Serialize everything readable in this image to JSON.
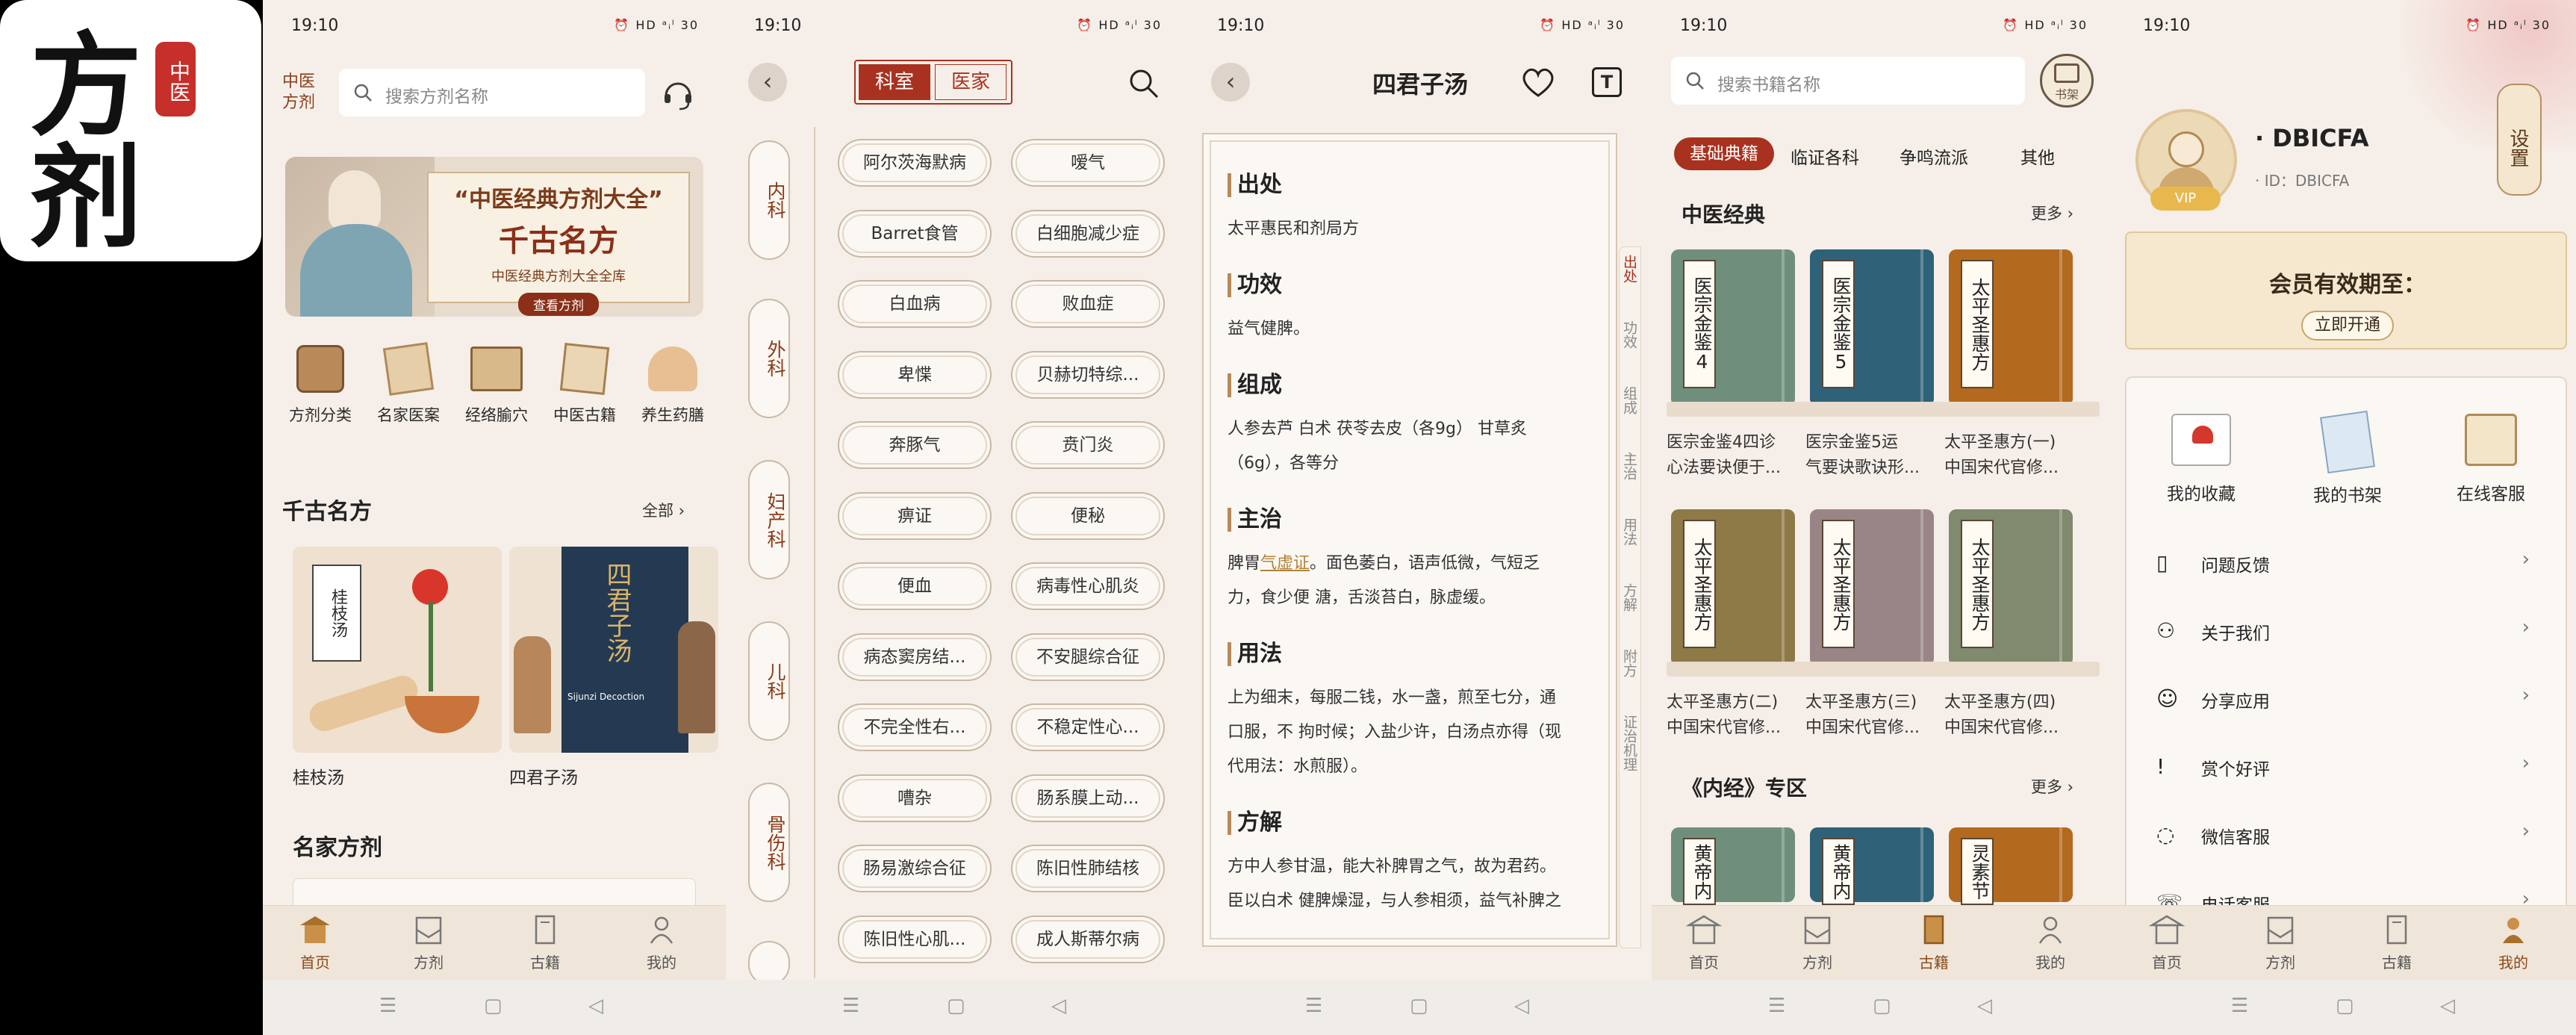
{
  "app_logo": {
    "main": "方剂",
    "seal": "中医"
  },
  "status": {
    "time": "19:10",
    "icons": "⏰ HD ᵃᵢˡ 30"
  },
  "s1": {
    "logo_top": "中医",
    "logo_bottom": "方剂",
    "search_placeholder": "搜索方剂名称",
    "banner": {
      "title_top": "“中医经典方剂大全”",
      "title_main": "千古名方",
      "subtitle": "中医经典方剂大全全库",
      "button": "查看方剂"
    },
    "categories": [
      "方剂分类",
      "名家医案",
      "经络腧穴",
      "中医古籍",
      "养生药膳"
    ],
    "section1": {
      "title": "千古名方",
      "more": "全部"
    },
    "cards": [
      {
        "name": "桂枝汤",
        "art_text": "桂枝汤"
      },
      {
        "name": "四君子汤",
        "art_text": "四君子汤",
        "art_en": "Sijunzi Decoction"
      }
    ],
    "section2": {
      "title": "名家方剂"
    }
  },
  "tabs": [
    "首页",
    "方剂",
    "古籍",
    "我的"
  ],
  "s2": {
    "seg_left": "科室",
    "seg_right": "医家",
    "side": [
      "内科",
      "外科",
      "妇产科",
      "儿科",
      "骨伤科"
    ],
    "diseases": [
      "阿尔茨海默病",
      "嗳气",
      "Barret食管",
      "白细胞减少症",
      "白血病",
      "败血症",
      "卑惵",
      "贝赫切特综...",
      "奔豚气",
      "贲门炎",
      "痹证",
      "便秘",
      "便血",
      "病毒性心肌炎",
      "病态窦房结...",
      "不安腿综合征",
      "不完全性右...",
      "不稳定性心...",
      "嘈杂",
      "肠系膜上动...",
      "肠易激综合征",
      "陈旧性肺结核",
      "陈旧性心肌...",
      "成人斯蒂尔病"
    ]
  },
  "s3": {
    "title": "四君子汤",
    "font_btn": "T",
    "sections": [
      {
        "h": "出处",
        "p": [
          "太平惠民和剂局方"
        ]
      },
      {
        "h": "功效",
        "p": [
          "益气健脾。"
        ]
      },
      {
        "h": "组成",
        "p": [
          "人参去芦 白术 茯苓去皮（各9g） 甘草炙",
          "（6g），各等分"
        ]
      },
      {
        "h": "主治",
        "p1_pre": "脾胃",
        "p1_link": "气虚证",
        "p1_post": "。面色萎白，语声低微，气短乏",
        "p": [
          "力，食少便 溏，舌淡苔白，脉虚缓。"
        ]
      },
      {
        "h": "用法",
        "p": [
          "上为细末，每服二钱，水一盏，煎至七分，通",
          "口服，不 拘时候；入盐少许，白汤点亦得（现",
          "代用法：水煎服）。"
        ]
      },
      {
        "h": "方解",
        "p": [
          "方中人参甘温，能大补脾胃之气，故为君药。",
          "臣以白术 健脾燥湿，与人参相须，益气补脾之"
        ]
      }
    ],
    "side_index": [
      "出处",
      "功效",
      "组成",
      "主治",
      "用法",
      "方解",
      "附方",
      "证治机理"
    ]
  },
  "s4": {
    "search_placeholder": "搜索书籍名称",
    "shelf_label": "书架",
    "tabs": [
      "基础典籍",
      "临证各科",
      "争鸣流派",
      "其他"
    ],
    "section1": {
      "title": "中医经典",
      "more": "更多"
    },
    "books1": [
      {
        "label": "医宗金鉴4",
        "t1": "医宗金鉴4四诊",
        "t2": "心法要诀便于...",
        "color": "#6f8f7c"
      },
      {
        "label": "医宗金鉴5",
        "t1": "医宗金鉴5运",
        "t2": "气要诀歌诀形...",
        "color": "#2f6278"
      },
      {
        "label": "太平圣惠方",
        "t1": "太平圣惠方(一)",
        "t2": "中国宋代官修...",
        "color": "#b36a1e"
      }
    ],
    "books2": [
      {
        "label": "太平圣惠方",
        "t1": "太平圣惠方(二)",
        "t2": "中国宋代官修...",
        "color": "#8e7a47"
      },
      {
        "label": "太平圣惠方",
        "t1": "太平圣惠方(三)",
        "t2": "中国宋代官修...",
        "color": "#9a8586"
      },
      {
        "label": "太平圣惠方",
        "t1": "太平圣惠方(四)",
        "t2": "中国宋代官修...",
        "color": "#7f8a6e"
      }
    ],
    "section2": {
      "title": "《内经》专区",
      "more": "更多"
    },
    "books3": [
      {
        "label": "黄帝内",
        "color": "#6f8f7c"
      },
      {
        "label": "黄帝内",
        "color": "#2f6278"
      },
      {
        "label": "灵素节",
        "color": "#b36a1e"
      }
    ]
  },
  "s5": {
    "settings": "设置",
    "username": "DBICFA",
    "user_id": "ID：DBICFA",
    "vip": "VIP",
    "member_title": "会员有效期至：",
    "member_btn": "立即开通",
    "quick": [
      "我的收藏",
      "我的书架",
      "在线客服"
    ],
    "menu": [
      "问题反馈",
      "关于我们",
      "分享应用",
      "赏个好评",
      "微信客服",
      "电话客服"
    ]
  }
}
